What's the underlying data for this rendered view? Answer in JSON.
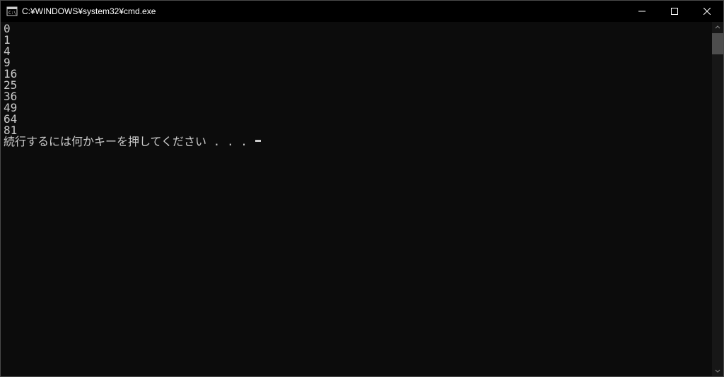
{
  "window": {
    "title": "C:¥WINDOWS¥system32¥cmd.exe"
  },
  "console": {
    "lines": [
      "0",
      "1",
      "4",
      "9",
      "16",
      "25",
      "36",
      "49",
      "64",
      "81"
    ],
    "prompt": "続行するには何かキーを押してください . . . "
  }
}
